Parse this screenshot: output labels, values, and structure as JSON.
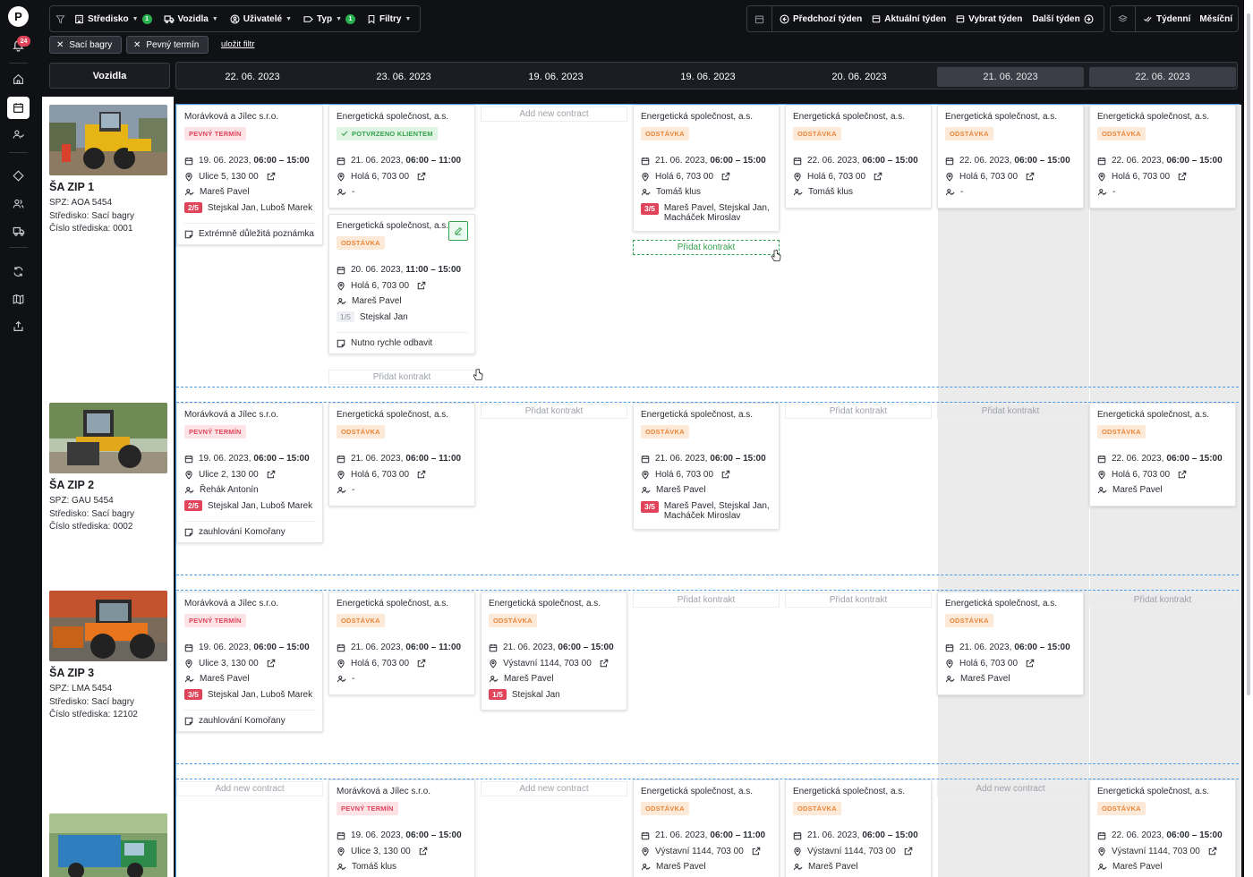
{
  "rail": {
    "notifications": "24"
  },
  "toolbar": {
    "stredisko": "Středisko",
    "stredisko_count": "1",
    "vozidla": "Vozidla",
    "uzivatele": "Uživatelé",
    "typ": "Typ",
    "typ_count": "1",
    "filtry": "Filtry",
    "prev_week": "Předchozí týden",
    "current_week": "Aktuální týden",
    "pick_week": "Vybrat týden",
    "next_week": "Další týden",
    "weekly": "Týdenní",
    "monthly": "Měsíční"
  },
  "filters": {
    "chips": [
      "Sací bagry",
      "Pevný termín"
    ],
    "save": "uložit filtr"
  },
  "header": {
    "vehicles": "Vozidla",
    "dates": [
      "22. 06. 2023",
      "23. 06. 2023",
      "19. 06. 2023",
      "19. 06. 2023",
      "20. 06. 2023",
      "21. 06. 2023",
      "22. 06. 2023"
    ]
  },
  "vehicles": [
    {
      "name": "ŠA ZIP 1",
      "spz": "SPZ: AOA 5454",
      "stredisko": "Středisko: Sací bagry",
      "cislo": "Číslo střediska: 0001"
    },
    {
      "name": "ŠA ZIP 2",
      "spz": "SPZ: GAU 5454",
      "stredisko": "Středisko: Sací bagry",
      "cislo": "Číslo střediska: 0002"
    },
    {
      "name": "ŠA ZIP 3",
      "spz": "SPZ: LMA 5454",
      "stredisko": "Středisko: Sací bagry",
      "cislo": "Číslo střediska: 12102"
    }
  ],
  "add": {
    "en": "Add new contract",
    "cz": "Přidat kontrakt"
  },
  "cards": [
    {
      "company": "Morávková a Jílec s.r.o.",
      "status": "PEVNÝ TERMÍN",
      "kind": "pevny",
      "date": "19. 06. 2023,",
      "time": "06:00 – 15:00",
      "address": "Ulice 5, 130 00",
      "person": "Mareš Pavel",
      "count": "2/5",
      "crew": "Stejskal Jan, Luboš Marek",
      "note": "Extrémně důležitá poznámka"
    },
    {
      "company": "Energetická společnost, a.s.",
      "status": "POTVRZENO KLIENTEM",
      "kind": "potv",
      "date": "21. 06. 2023,",
      "time": "06:00 – 11:00",
      "address": "Holá 6, 703 00",
      "person": "-"
    },
    {
      "company": "Energetická společnost, a.s.",
      "status": "ODSTÁVKA",
      "kind": "odst",
      "date": "20. 06. 2023,",
      "time": "11:00 – 15:00",
      "address": "Holá 6, 703 00",
      "person": "Mareš Pavel",
      "count": "1/5",
      "crew": "Stejskal Jan",
      "note": "Nutno rychle odbavit"
    },
    {
      "company": "Energetická společnost, a.s.",
      "status": "ODSTÁVKA",
      "kind": "odst",
      "date": "21. 06. 2023,",
      "time": "06:00 – 15:00",
      "address": "Holá 6, 703 00",
      "person": "Tomáš klus",
      "count": "3/5",
      "crew": "Mareš Pavel, Stejskal Jan, Macháček Miroslav"
    },
    {
      "company": "Energetická společnost, a.s.",
      "status": "ODSTÁVKA",
      "kind": "odst",
      "date": "22. 06. 2023,",
      "time": "06:00 – 15:00",
      "address": "Holá 6, 703 00",
      "person": "Tomáš klus"
    },
    {
      "company": "Energetická společnost, a.s.",
      "status": "ODSTÁVKA",
      "kind": "odst",
      "date": "22. 06. 2023,",
      "time": "06:00 – 15:00",
      "address": "Holá 6, 703 00",
      "person": "-"
    },
    {
      "company": "Energetická společnost, a.s.",
      "status": "ODSTÁVKA",
      "kind": "odst",
      "date": "22. 06. 2023,",
      "time": "06:00 – 15:00",
      "address": "Holá 6, 703 00",
      "person": "-"
    },
    {
      "company": "Morávková a Jílec s.r.o.",
      "status": "PEVNÝ TERMÍN",
      "kind": "pevny",
      "date": "19. 06. 2023,",
      "time": "06:00 – 15:00",
      "address": "Ulice 2, 130 00",
      "person": "Řehák Antonín",
      "count": "2/5",
      "crew": "Stejskal Jan, Luboš Marek",
      "note": "zauhlování Komořany"
    },
    {
      "company": "Energetická společnost, a.s.",
      "status": "ODSTÁVKA",
      "kind": "odst",
      "date": "21. 06. 2023,",
      "time": "06:00 – 11:00",
      "address": "Holá 6, 703 00",
      "person": "-"
    },
    {
      "company": "Energetická společnost, a.s.",
      "status": "ODSTÁVKA",
      "kind": "odst",
      "date": "21. 06. 2023,",
      "time": "06:00 – 15:00",
      "address": "Holá 6, 703 00",
      "person": "Mareš Pavel",
      "count": "3/5",
      "crew": "Mareš Pavel, Stejskal Jan, Macháček Miroslav"
    },
    {
      "company": "Energetická společnost, a.s.",
      "status": "ODSTÁVKA",
      "kind": "odst",
      "date": "22. 06. 2023,",
      "time": "06:00 – 15:00",
      "address": "Holá 6, 703 00",
      "person": "Mareš Pavel"
    },
    {
      "company": "Morávková a Jílec s.r.o.",
      "status": "PEVNÝ TERMÍN",
      "kind": "pevny",
      "date": "19. 06. 2023,",
      "time": "06:00 – 15:00",
      "address": "Ulice 3, 130 00",
      "person": "Mareš Pavel",
      "count": "3/5",
      "crew": "Stejskal Jan, Luboš Marek",
      "note": "zauhlování Komořany"
    },
    {
      "company": "Energetická společnost, a.s.",
      "status": "ODSTÁVKA",
      "kind": "odst",
      "date": "21. 06. 2023,",
      "time": "06:00 – 11:00",
      "address": "Holá 6, 703 00",
      "person": "-"
    },
    {
      "company": "Energetická společnost, a.s.",
      "status": "ODSTÁVKA",
      "kind": "odst",
      "date": "21. 06. 2023,",
      "time": "06:00 – 15:00",
      "address": "Výstavní 1144, 703 00",
      "person": "Mareš Pavel",
      "count": "1/5",
      "crew": "Stejskal Jan"
    },
    {
      "company": "Energetická společnost, a.s.",
      "status": "ODSTÁVKA",
      "kind": "odst",
      "date": "21. 06. 2023,",
      "time": "06:00 – 15:00",
      "address": "Holá 6, 703 00",
      "person": "Mareš Pavel"
    },
    {
      "company": "Morávková a Jílec s.r.o.",
      "status": "PEVNÝ TERMÍN",
      "kind": "pevny",
      "date": "19. 06. 2023,",
      "time": "06:00 – 15:00",
      "address": "Ulice 3, 130 00",
      "person": "Tomáš klus"
    },
    {
      "company": "Energetická společnost, a.s.",
      "status": "ODSTÁVKA",
      "kind": "odst",
      "date": "21. 06. 2023,",
      "time": "06:00 – 11:00",
      "address": "Výstavní 1144, 703 00",
      "person": "Mareš Pavel"
    },
    {
      "company": "Energetická společnost, a.s.",
      "status": "ODSTÁVKA",
      "kind": "odst",
      "date": "21. 06. 2023,",
      "time": "06:00 – 15:00",
      "address": "Výstavní 1144, 703 00",
      "person": "Mareš Pavel"
    },
    {
      "company": "Energetická společnost, a.s.",
      "status": "ODSTÁVKA",
      "kind": "odst",
      "date": "22. 06. 2023,",
      "time": "06:00 – 15:00",
      "address": "Výstavní 1144, 703 00",
      "person": "Mareš Pavel"
    }
  ]
}
